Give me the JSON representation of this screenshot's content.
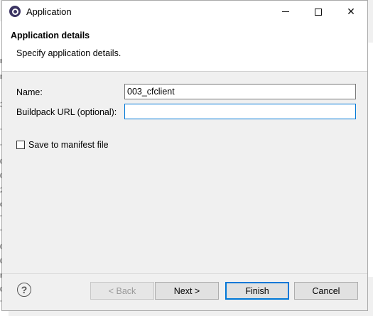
{
  "window": {
    "title": "Application"
  },
  "header": {
    "title": "Application details",
    "description": "Specify application details."
  },
  "form": {
    "name_label": "Name:",
    "name_value": "003_cfclient",
    "buildpack_label": "Buildpack URL (optional):",
    "buildpack_value": "",
    "save_manifest_label": "Save to manifest file",
    "save_manifest_checked": false
  },
  "buttons": {
    "back": "< Back",
    "next": "Next >",
    "finish": "Finish",
    "cancel": "Cancel"
  },
  "colors": {
    "accent": "#0078d7",
    "icon": "#3b3462"
  }
}
